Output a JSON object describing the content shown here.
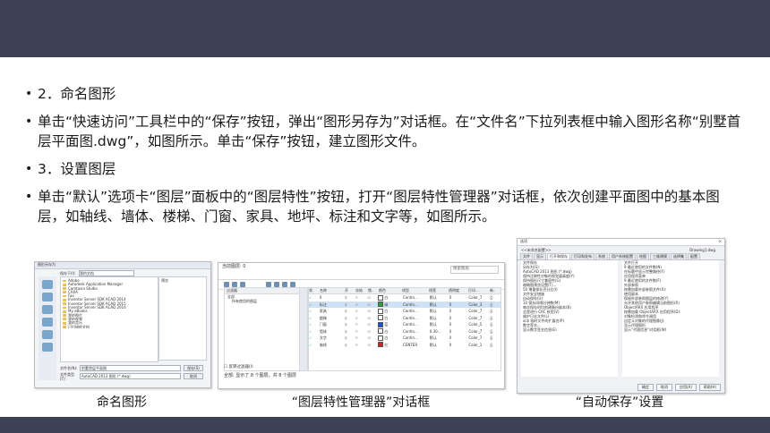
{
  "slide": {
    "colors": {
      "band": "#3d4354"
    },
    "bullets": [
      "2．命名图形",
      "单击“快速访问”工具栏中的“保存”按钮，弹出“图形另存为”对话框。在“文件名”下拉列表框中输入图形名称“别墅首层平面图.dwg”，如图所示。单击“保存”按钮，建立图形文件。",
      "3．设置图层",
      "单击“默认”选项卡“图层”面板中的“图层特性”按钮，打开“图层特性管理器”对话框，依次创建平面图中的基本图层，如轴线、墙体、楼梯、门窗、家具、地坪、标注和文字等，如图所示。"
    ],
    "captions": [
      "命名图形",
      "“图层特性管理器”对话框",
      "“自动保存”设置"
    ]
  },
  "save_dialog": {
    "title": "图形另存为",
    "save_in_label": "保存于(I):",
    "save_in_value": "我的文档",
    "folders": [
      "Adobe",
      "Autodesk Application Manager",
      "Camtasia Studio",
      "CAXA",
      "Fax",
      "Inventor Server SDK ACAD 2014",
      "Inventor Server SDK ACAD 2015",
      "Inventor Server SDK ACAD 2016",
      "My eBooks",
      "我的图片",
      "我的视频",
      "我的音乐",
      "已扫描的文档"
    ],
    "preview_label": "预览",
    "filename_label": "文件名(N):",
    "filename_value": "别墅首层平面图",
    "filetype_label": "文件类型(T):",
    "filetype_value": "AutoCAD 2013 图形 (*.dwg)",
    "save_button": "保存(S)",
    "cancel_button": "取消"
  },
  "layer_manager": {
    "current_layer": "当前图层: 0",
    "search_placeholder": "搜索图层",
    "filters_header": "过滤器",
    "filter_all": "全部",
    "filter_used": "所有使用的图层",
    "invert_filter": "反转过滤器(I)",
    "columns": [
      "状.",
      "名称",
      "开",
      "冻结",
      "锁..",
      "颜色",
      "线型",
      "线宽",
      "透明度",
      "打印...",
      "新.."
    ],
    "rows": [
      {
        "name": "0",
        "color_hex": "#ffffff",
        "color": "白",
        "linetype": "Contin...",
        "lineweight": "默认",
        "transparency": "0",
        "plot": "Color_7"
      },
      {
        "name": "标注",
        "color_hex": "#2f9e3a",
        "color": "绿",
        "linetype": "Contin...",
        "lineweight": "默认",
        "transparency": "0",
        "plot": "Color_3"
      },
      {
        "name": "家具",
        "color_hex": "#ffffff",
        "color": "白",
        "linetype": "Contin...",
        "lineweight": "默认",
        "transparency": "0",
        "plot": "Color_7"
      },
      {
        "name": "楼梯",
        "color_hex": "#ffffff",
        "color": "白",
        "linetype": "Contin...",
        "lineweight": "默认",
        "transparency": "0",
        "plot": "Color_7"
      },
      {
        "name": "门窗",
        "color_hex": "#1c4fd8",
        "color": "蓝",
        "linetype": "Contin...",
        "lineweight": "默认",
        "transparency": "0",
        "plot": "Color_5"
      },
      {
        "name": "墙体",
        "color_hex": "#ffffff",
        "color": "白",
        "linetype": "Contin...",
        "lineweight": "0.30...",
        "transparency": "0",
        "plot": "Color_7"
      },
      {
        "name": "文字",
        "color_hex": "#ffffff",
        "color": "白",
        "linetype": "Contin...",
        "lineweight": "默认",
        "transparency": "0",
        "plot": "Color_7"
      },
      {
        "name": "轴线",
        "color_hex": "#d21f1f",
        "color": "红",
        "linetype": "CENTER",
        "lineweight": "默认",
        "transparency": "0",
        "plot": "Color_1"
      }
    ],
    "status": "全部: 显示了 8 个图层，共 8 个图层"
  },
  "options_dialog": {
    "title": "选项",
    "current_config": "<<未命名配置>>",
    "current_drawing": "Drawing1.dwg",
    "tabs": [
      "文件",
      "显示",
      "打开和保存",
      "打印和发布",
      "系统",
      "用户系统配置",
      "绘图",
      "三维建模",
      "选择集",
      "配置"
    ],
    "left_pane": [
      "文件保存",
      "另存为(S):",
      "AutoCAD 2013 图形 (*.dwg)",
      "保持注释性对象的视觉逼真度(Y)",
      "保持图形尺寸兼容性(G)",
      "缩略图预览设置(T)...",
      "50   增量保存百分比(I)",
      "文件安全措施",
      "自动保存(U)",
      "10   保存间隔分钟数(M)",
      "每次保存时均创建备份副本(B)",
      "总是进行 CRC 校验(V)",
      "维护日志文件(L)",
      "ac$   临时文件的扩展名(P)",
      "数字签名...",
      "显示数字签名信息(E)"
    ],
    "right_pane": [
      "文件打开",
      "9   最近使用的文件数(N)",
      "在标题中显示完整路径(F)",
      "应用程序菜单",
      "9   最近使用的文件数(F)",
      "外部参照",
      "按需加载外部参照文件(X):",
      "使用副本",
      "保留外部参照图层的修改(Y)",
      "允许其他用户参照编辑当前图形(R)",
      "ObjectARX 应用程序",
      "按需加载 ObjectARX 应用程序(D):",
      "对象检测和命令调用",
      "自定义对象的代理图像(J):",
      "显示代理图形",
      "显示“代理信息”对话框(W)"
    ],
    "buttons": [
      "确定",
      "取消",
      "应用(A)",
      "帮助(H)"
    ]
  }
}
